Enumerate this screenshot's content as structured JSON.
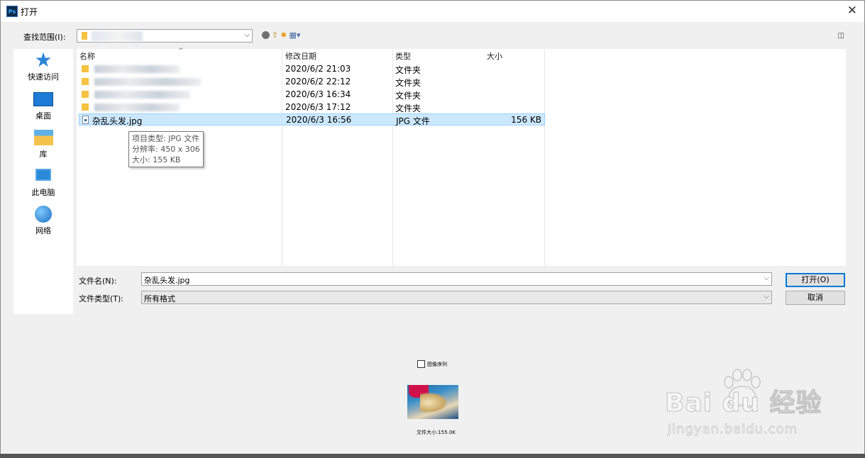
{
  "window": {
    "title": "打开",
    "app_icon": "Ps",
    "close_label": "✕"
  },
  "lookin": {
    "label": "查找范围(I):",
    "value": ""
  },
  "toolbar": {
    "icons": [
      "back-icon",
      "up-folder-icon",
      "new-folder-icon",
      "view-menu-icon"
    ]
  },
  "places": [
    {
      "label": "快速访问",
      "icon": "star-icon"
    },
    {
      "label": "桌面",
      "icon": "desktop-icon"
    },
    {
      "label": "库",
      "icon": "library-icon"
    },
    {
      "label": "此电脑",
      "icon": "computer-icon"
    },
    {
      "label": "网络",
      "icon": "network-icon"
    }
  ],
  "columns": {
    "name": "名称",
    "date": "修改日期",
    "type": "类型",
    "size": "大小"
  },
  "files": [
    {
      "name": "",
      "date": "2020/6/2 21:03",
      "type": "文件夹",
      "size": "",
      "kind": "folder"
    },
    {
      "name": "",
      "date": "2020/6/2 22:12",
      "type": "文件夹",
      "size": "",
      "kind": "folder"
    },
    {
      "name": "",
      "date": "2020/6/3 16:34",
      "type": "文件夹",
      "size": "",
      "kind": "folder"
    },
    {
      "name": "",
      "date": "2020/6/3 17:12",
      "type": "文件夹",
      "size": "",
      "kind": "folder"
    },
    {
      "name": "杂乱头发.jpg",
      "date": "2020/6/3 16:56",
      "type": "JPG 文件",
      "size": "156 KB",
      "kind": "jpg"
    }
  ],
  "tooltip": {
    "type_line": "项目类型: JPG 文件",
    "resolution_line": "分辨率: 450 x 306",
    "size_line": "大小: 155 KB"
  },
  "filename": {
    "label": "文件名(N):",
    "value": "杂乱头发.jpg"
  },
  "filetype": {
    "label": "文件类型(T):",
    "value": "所有格式"
  },
  "buttons": {
    "open": "打开(O)",
    "cancel": "取消"
  },
  "preview": {
    "image_sequence_label": "图像序列",
    "file_size_label": "文件大小:155.0K"
  },
  "watermark": {
    "main": "Bai du 经验",
    "sub": "jingyan.baidu.com"
  }
}
